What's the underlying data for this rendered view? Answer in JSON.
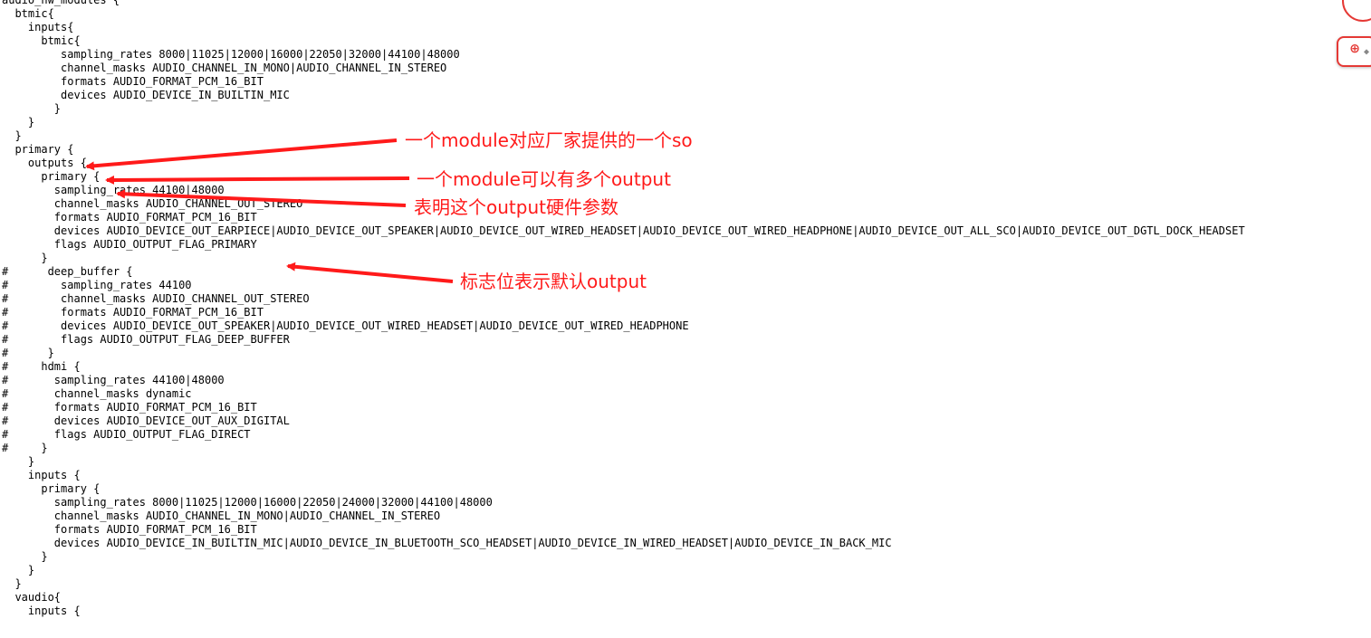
{
  "code_lines": [
    "audio_hw_modules {",
    "  btmic{",
    "    inputs{",
    "      btmic{",
    "         sampling_rates 8000|11025|12000|16000|22050|32000|44100|48000",
    "         channel_masks AUDIO_CHANNEL_IN_MONO|AUDIO_CHANNEL_IN_STEREO",
    "         formats AUDIO_FORMAT_PCM_16_BIT",
    "         devices AUDIO_DEVICE_IN_BUILTIN_MIC",
    "        }",
    "    }",
    "  }",
    "  primary {",
    "    outputs {",
    "      primary {",
    "        sampling_rates 44100|48000",
    "        channel_masks AUDIO_CHANNEL_OUT_STEREO",
    "        formats AUDIO_FORMAT_PCM_16_BIT",
    "        devices AUDIO_DEVICE_OUT_EARPIECE|AUDIO_DEVICE_OUT_SPEAKER|AUDIO_DEVICE_OUT_WIRED_HEADSET|AUDIO_DEVICE_OUT_WIRED_HEADPHONE|AUDIO_DEVICE_OUT_ALL_SCO|AUDIO_DEVICE_OUT_DGTL_DOCK_HEADSET",
    "        flags AUDIO_OUTPUT_FLAG_PRIMARY",
    "      }",
    "#      deep_buffer {",
    "#        sampling_rates 44100",
    "#        channel_masks AUDIO_CHANNEL_OUT_STEREO",
    "#        formats AUDIO_FORMAT_PCM_16_BIT",
    "#        devices AUDIO_DEVICE_OUT_SPEAKER|AUDIO_DEVICE_OUT_WIRED_HEADSET|AUDIO_DEVICE_OUT_WIRED_HEADPHONE",
    "#        flags AUDIO_OUTPUT_FLAG_DEEP_BUFFER",
    "#      }",
    "#     hdmi {",
    "#       sampling_rates 44100|48000",
    "#       channel_masks dynamic",
    "#       formats AUDIO_FORMAT_PCM_16_BIT",
    "#       devices AUDIO_DEVICE_OUT_AUX_DIGITAL",
    "#       flags AUDIO_OUTPUT_FLAG_DIRECT",
    "#     }",
    "    }",
    "    inputs {",
    "      primary {",
    "        sampling_rates 8000|11025|12000|16000|22050|24000|32000|44100|48000",
    "        channel_masks AUDIO_CHANNEL_IN_MONO|AUDIO_CHANNEL_IN_STEREO",
    "        formats AUDIO_FORMAT_PCM_16_BIT",
    "        devices AUDIO_DEVICE_IN_BUILTIN_MIC|AUDIO_DEVICE_IN_BLUETOOTH_SCO_HEADSET|AUDIO_DEVICE_IN_WIRED_HEADSET|AUDIO_DEVICE_IN_BACK_MIC",
    "      }",
    "    }",
    "  }",
    "  vaudio{",
    "    inputs {"
  ],
  "annotations": {
    "so_note": "一个module对应厂家提供的一个so",
    "outputs_note": "一个module可以有多个output",
    "hw_params_note": "表明这个output硬件参数",
    "flag_note": "标志位表示默认output"
  },
  "colors": {
    "annotation": "#ff1a1a",
    "text": "#000000",
    "background": "#ffffff"
  }
}
